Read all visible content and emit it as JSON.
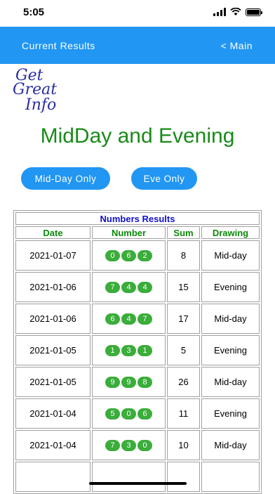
{
  "status": {
    "time": "5:05"
  },
  "nav": {
    "title": "Current Results",
    "back": "< Main"
  },
  "logo": {
    "line1": "Get",
    "line2": "Great",
    "line3": "Info"
  },
  "page": {
    "title": "MidDay and Evening"
  },
  "filters": {
    "midday": "Mid-Day Only",
    "eve": "Eve Only"
  },
  "table": {
    "caption": "Numbers Results",
    "headers": [
      "Date",
      "Number",
      "Sum",
      "Drawing"
    ],
    "rows": [
      {
        "date": "2021-01-07",
        "digits": [
          "0",
          "6",
          "2"
        ],
        "sum": "8",
        "drawing": "Mid-day"
      },
      {
        "date": "2021-01-06",
        "digits": [
          "7",
          "4",
          "4"
        ],
        "sum": "15",
        "drawing": "Evening"
      },
      {
        "date": "2021-01-06",
        "digits": [
          "6",
          "4",
          "7"
        ],
        "sum": "17",
        "drawing": "Mid-day"
      },
      {
        "date": "2021-01-05",
        "digits": [
          "1",
          "3",
          "1"
        ],
        "sum": "5",
        "drawing": "Evening"
      },
      {
        "date": "2021-01-05",
        "digits": [
          "9",
          "9",
          "8"
        ],
        "sum": "26",
        "drawing": "Mid-day"
      },
      {
        "date": "2021-01-04",
        "digits": [
          "5",
          "0",
          "6"
        ],
        "sum": "11",
        "drawing": "Evening"
      },
      {
        "date": "2021-01-04",
        "digits": [
          "7",
          "3",
          "0"
        ],
        "sum": "10",
        "drawing": "Mid-day"
      }
    ]
  },
  "colors": {
    "accent": "#2196f3",
    "title_green": "#1a8a1a",
    "ball_green": "#3aad3a",
    "caption_blue": "#1010cc"
  }
}
